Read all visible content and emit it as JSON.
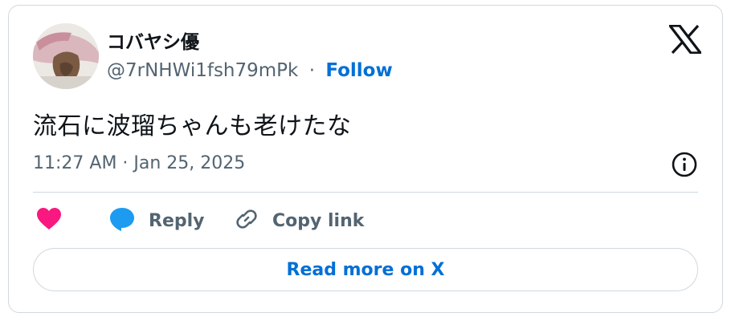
{
  "author": {
    "display_name": "コバヤシ優",
    "handle": "@7rNHWi1fsh79mPk",
    "separator": "·",
    "follow_label": "Follow"
  },
  "tweet": {
    "text": "流石に波瑠ちゃんも老けたな",
    "timestamp": "11:27 AM · Jan 25, 2025"
  },
  "actions": {
    "reply_label": "Reply",
    "copy_link_label": "Copy link",
    "read_more_label": "Read more on X"
  },
  "colors": {
    "accent_blue": "#006fd6",
    "heart_pink": "#f91880",
    "reply_blue": "#1d9bf0",
    "muted_text": "#536471",
    "border": "#cfd9de"
  },
  "icons": {
    "logo": "x-logo-icon",
    "info": "info-icon",
    "like": "heart-icon",
    "reply": "speech-bubble-icon",
    "copy_link": "link-icon"
  }
}
